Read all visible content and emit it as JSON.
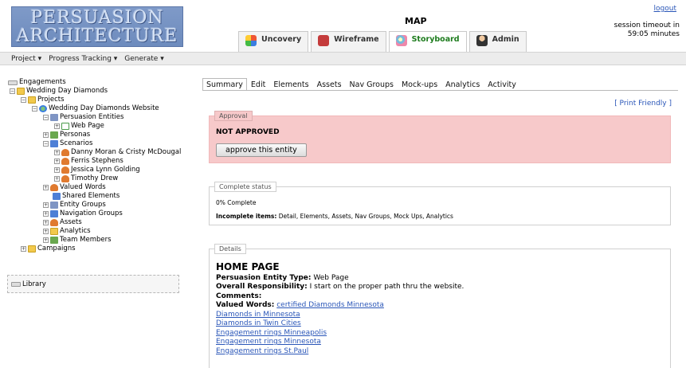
{
  "logo": {
    "line1": "PERSUASION",
    "line2": "ARCHITECTURE"
  },
  "header": {
    "title": "MAP",
    "logout": "logout",
    "session_line1": "session timeout in",
    "session_line2": "59:05 minutes"
  },
  "app_tabs": [
    {
      "label": "Uncovery",
      "icon": "uncovery-icon"
    },
    {
      "label": "Wireframe",
      "icon": "wireframe-icon"
    },
    {
      "label": "Storyboard",
      "icon": "storyboard-icon",
      "active": true
    },
    {
      "label": "Admin",
      "icon": "admin-icon"
    }
  ],
  "menu": [
    "Project ▾",
    "Progress Tracking ▾",
    "Generate ▾"
  ],
  "tree": {
    "engagements": "Engagements",
    "wedding": "Wedding Day Diamonds",
    "projects": "Projects",
    "website": "Wedding Day Diamonds Website",
    "persuasion_entities": "Persuasion Entities",
    "web_page": "Web Page",
    "personas": "Personas",
    "scenarios": "Scenarios",
    "scen1": "Danny Moran & Cristy McDougal",
    "scen2": "Ferris Stephens",
    "scen3": "Jessica Lynn Golding",
    "scen4": "Timothy Drew",
    "valued_words": "Valued Words",
    "shared_elements": "Shared Elements",
    "entity_groups": "Entity Groups",
    "navigation_groups": "Navigation Groups",
    "assets": "Assets",
    "analytics": "Analytics",
    "team_members": "Team Members",
    "campaigns": "Campaigns"
  },
  "library": "Library",
  "content_tabs": [
    "Summary",
    "Edit",
    "Elements",
    "Assets",
    "Nav Groups",
    "Mock-ups",
    "Analytics",
    "Activity"
  ],
  "print_friendly": "[ Print Friendly ]",
  "approval": {
    "legend": "Approval",
    "status": "NOT APPROVED",
    "button": "approve this entity"
  },
  "complete": {
    "legend": "Complete status",
    "percent": "0% Complete",
    "incomplete_label": "Incomplete items:",
    "incomplete_items": "Detail, Elements, Assets, Nav Groups, Mock Ups, Analytics"
  },
  "details": {
    "legend": "Details",
    "heading": "HOME PAGE",
    "type_label": "Persuasion Entity Type:",
    "type_value": "Web Page",
    "resp_label": "Overall Responsibility:",
    "resp_value": "I start on the proper path thru the website.",
    "comments_label": "Comments:",
    "valued_label": "Valued Words:",
    "valued_words": [
      "certified Diamonds Minnesota",
      "Diamonds in Minnesota",
      "Diamonds in Twin Cities",
      "Engagement rings Minneapolis",
      "Engagement rings Minnesota",
      "Engagement rings St.Paul"
    ]
  }
}
